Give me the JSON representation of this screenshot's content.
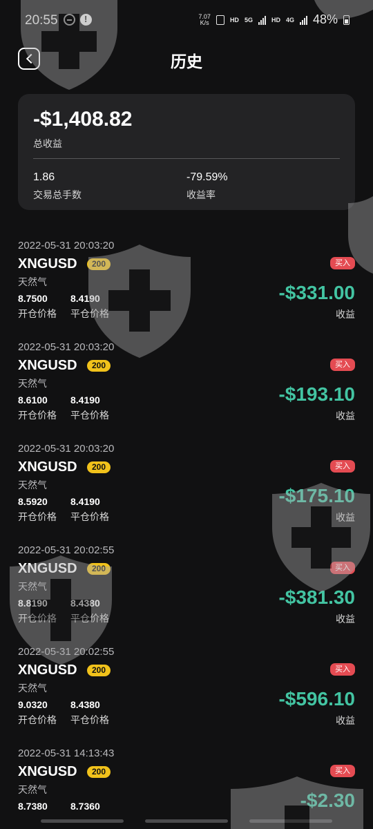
{
  "status_bar": {
    "time": "20:55",
    "speed_value": "7.07",
    "speed_unit": "K/s",
    "hd_1": "HD",
    "net_5g": "5G",
    "hd_2": "HD",
    "net_4g": "4G",
    "battery": "48%"
  },
  "header": {
    "title": "历史"
  },
  "summary": {
    "total_profit": "-$1,408.82",
    "total_profit_label": "总收益",
    "total_lots": "1.86",
    "total_lots_label": "交易总手数",
    "return_rate": "-79.59%",
    "return_rate_label": "收益率"
  },
  "labels": {
    "open_price": "开仓价格",
    "close_price": "平仓价格",
    "profit": "收益"
  },
  "trades": [
    {
      "time": "2022-05-31 20:03:20",
      "symbol": "XNGUSD",
      "leverage": "200",
      "name": "天然气",
      "side": "买入",
      "open": "8.7500",
      "close": "8.4190",
      "profit": "-$331.00"
    },
    {
      "time": "2022-05-31 20:03:20",
      "symbol": "XNGUSD",
      "leverage": "200",
      "name": "天然气",
      "side": "买入",
      "open": "8.6100",
      "close": "8.4190",
      "profit": "-$193.10"
    },
    {
      "time": "2022-05-31 20:03:20",
      "symbol": "XNGUSD",
      "leverage": "200",
      "name": "天然气",
      "side": "买入",
      "open": "8.5920",
      "close": "8.4190",
      "profit": "-$175.10"
    },
    {
      "time": "2022-05-31 20:02:55",
      "symbol": "XNGUSD",
      "leverage": "200",
      "name": "天然气",
      "side": "买入",
      "open": "8.8190",
      "close": "8.4380",
      "profit": "-$381.30"
    },
    {
      "time": "2022-05-31 20:02:55",
      "symbol": "XNGUSD",
      "leverage": "200",
      "name": "天然气",
      "side": "买入",
      "open": "9.0320",
      "close": "8.4380",
      "profit": "-$596.10"
    },
    {
      "time": "2022-05-31 14:13:43",
      "symbol": "XNGUSD",
      "leverage": "200",
      "name": "天然气",
      "side": "买入",
      "open": "8.7380",
      "close": "8.7360",
      "profit": "-$2.30"
    }
  ],
  "colors": {
    "background": "#111112",
    "card": "#232325",
    "profit_text": "#43c4a2",
    "buy_badge": "#e44b52",
    "leverage_badge": "#f1c21b"
  },
  "icons": {
    "back": "back-arrow-icon",
    "watermark": "shield-cross-watermark-icon"
  }
}
